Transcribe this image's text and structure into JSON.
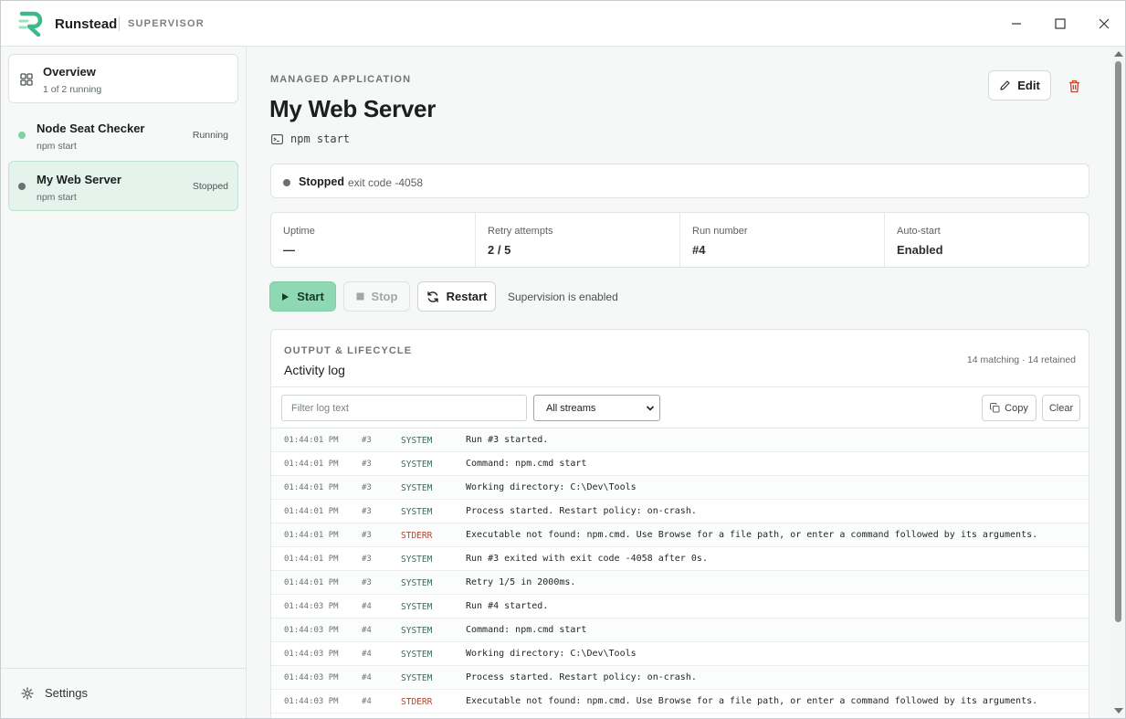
{
  "app": {
    "name": "Runstead",
    "subtitle": "SUPERVISOR"
  },
  "colors": {
    "accent": "#8ed8b4",
    "running_dot": "#7dd3a8",
    "stopped_dot": "#6b7170",
    "stderr": "#b4442c",
    "danger": "#c2462c"
  },
  "sidebar": {
    "overview": {
      "title": "Overview",
      "subtitle": "1 of 2 running",
      "icon": "grid-icon"
    },
    "apps": [
      {
        "name": "Node Seat Checker",
        "command": "npm start",
        "status": "Running",
        "active": false
      },
      {
        "name": "My Web Server",
        "command": "npm start",
        "status": "Stopped",
        "active": true
      }
    ],
    "settings_label": "Settings"
  },
  "main": {
    "eyebrow": "MANAGED APPLICATION",
    "title": "My Web Server",
    "command": "npm start",
    "edit_label": "Edit",
    "status": {
      "label": "Stopped",
      "detail": "exit code -4058"
    },
    "stats": [
      {
        "label": "Uptime",
        "value": "—"
      },
      {
        "label": "Retry attempts",
        "value": "2 / 5"
      },
      {
        "label": "Run number",
        "value": "#4"
      },
      {
        "label": "Auto-start",
        "value": "Enabled"
      }
    ],
    "actions": {
      "start_label": "Start",
      "stop_label": "Stop",
      "restart_label": "Restart",
      "supervision_text": "Supervision is enabled"
    }
  },
  "log": {
    "eyebrow": "OUTPUT & LIFECYCLE",
    "title": "Activity log",
    "count_text": "14 matching · 14 retained",
    "filter_placeholder": "Filter log text",
    "stream_selected": "All streams",
    "copy_label": "Copy",
    "clear_label": "Clear",
    "rows": [
      {
        "time": "01:44:01 PM",
        "run": "#3",
        "stream": "SYSTEM",
        "message": "Run #3 started."
      },
      {
        "time": "01:44:01 PM",
        "run": "#3",
        "stream": "SYSTEM",
        "message": "Command: npm.cmd start"
      },
      {
        "time": "01:44:01 PM",
        "run": "#3",
        "stream": "SYSTEM",
        "message": "Working directory: C:\\Dev\\Tools"
      },
      {
        "time": "01:44:01 PM",
        "run": "#3",
        "stream": "SYSTEM",
        "message": "Process started. Restart policy: on-crash."
      },
      {
        "time": "01:44:01 PM",
        "run": "#3",
        "stream": "STDERR",
        "message": "Executable not found: npm.cmd. Use Browse for a file path, or enter a command followed by its arguments."
      },
      {
        "time": "01:44:01 PM",
        "run": "#3",
        "stream": "SYSTEM",
        "message": "Run #3 exited with exit code -4058 after 0s."
      },
      {
        "time": "01:44:01 PM",
        "run": "#3",
        "stream": "SYSTEM",
        "message": "Retry 1/5 in 2000ms."
      },
      {
        "time": "01:44:03 PM",
        "run": "#4",
        "stream": "SYSTEM",
        "message": "Run #4 started."
      },
      {
        "time": "01:44:03 PM",
        "run": "#4",
        "stream": "SYSTEM",
        "message": "Command: npm.cmd start"
      },
      {
        "time": "01:44:03 PM",
        "run": "#4",
        "stream": "SYSTEM",
        "message": "Working directory: C:\\Dev\\Tools"
      },
      {
        "time": "01:44:03 PM",
        "run": "#4",
        "stream": "SYSTEM",
        "message": "Process started. Restart policy: on-crash."
      },
      {
        "time": "01:44:03 PM",
        "run": "#4",
        "stream": "STDERR",
        "message": "Executable not found: npm.cmd. Use Browse for a file path, or enter a command followed by its arguments."
      }
    ]
  }
}
